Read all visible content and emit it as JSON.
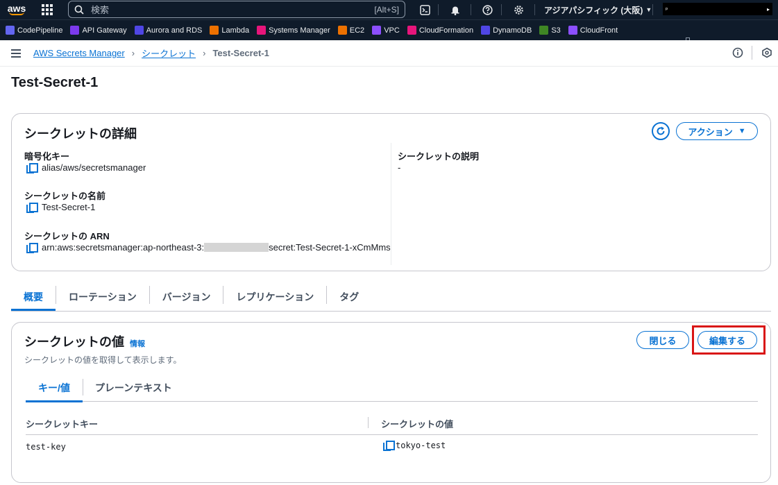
{
  "topnav": {
    "search_placeholder": "検索",
    "search_shortcut": "[Alt+S]",
    "region": "アジアパシフィック (大阪)",
    "account": "ᵖ"
  },
  "favorites": [
    {
      "label": "CodePipeline",
      "color": "#6366f1"
    },
    {
      "label": "API Gateway",
      "color": "#7c3aed"
    },
    {
      "label": "Aurora and RDS",
      "color": "#4f46e5"
    },
    {
      "label": "Lambda",
      "color": "#ed7100"
    },
    {
      "label": "Systems Manager",
      "color": "#e7157b"
    },
    {
      "label": "EC2",
      "color": "#ed7100"
    },
    {
      "label": "VPC",
      "color": "#8c4fff"
    },
    {
      "label": "CloudFormation",
      "color": "#e7157b"
    },
    {
      "label": "DynamoDB",
      "color": "#4f46e5"
    },
    {
      "label": "S3",
      "color": "#3f8624"
    },
    {
      "label": "CloudFront",
      "color": "#8c4fff"
    }
  ],
  "breadcrumb": {
    "root": "AWS Secrets Manager",
    "parent": "シークレット",
    "current": "Test-Secret-1"
  },
  "page_title": "Test-Secret-1",
  "details": {
    "heading": "シークレットの詳細",
    "action_label": "アクション",
    "encryption_key_label": "暗号化キー",
    "encryption_key_value": "alias/aws/secretsmanager",
    "name_label": "シークレットの名前",
    "name_value": "Test-Secret-1",
    "arn_label": "シークレットの ARN",
    "arn_prefix": "arn:aws:secretsmanager:ap-northeast-3:",
    "arn_suffix": "secret:Test-Secret-1-xCmMms",
    "description_label": "シークレットの説明",
    "description_value": "-"
  },
  "tabs": [
    "概要",
    "ローテーション",
    "バージョン",
    "レプリケーション",
    "タグ"
  ],
  "secret_value": {
    "heading": "シークレットの値",
    "info_label": "情報",
    "description": "シークレットの値を取得して表示します。",
    "close_label": "閉じる",
    "edit_label": "編集する",
    "subtabs": [
      "キー/値",
      "プレーンテキスト"
    ],
    "columns": [
      "シークレットキー",
      "シークレットの値"
    ],
    "rows": [
      {
        "key": "test-key",
        "value": "tokyo-test"
      }
    ]
  },
  "colors": {
    "accent": "#0972d3",
    "highlight": "#d91515",
    "nav_bg": "#0f1b2a"
  }
}
